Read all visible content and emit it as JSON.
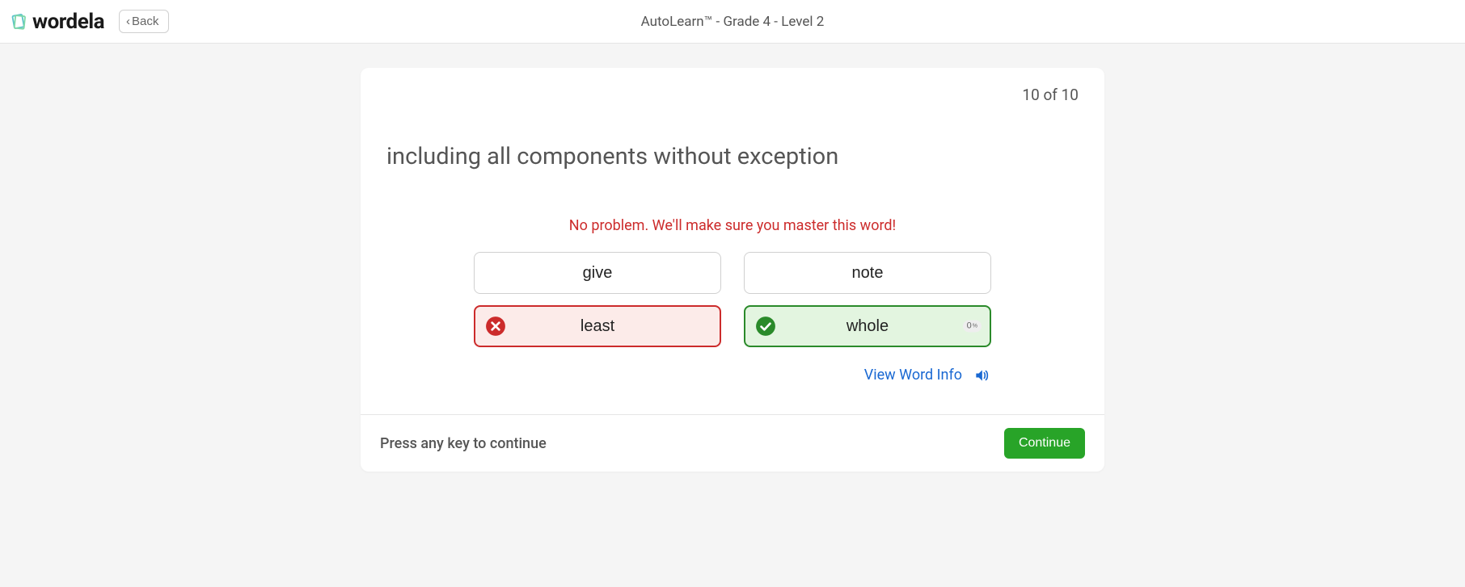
{
  "header": {
    "logo_text": "wordela",
    "back_label": "Back",
    "title": "AutoLearn™ - Grade 4 - Level 2"
  },
  "card": {
    "progress": "10 of 10",
    "prompt": "including all components without exception",
    "feedback": "No problem. We'll make sure you master this word!",
    "options": {
      "a": "give",
      "b": "note",
      "c": "least",
      "d": "whole",
      "d_badge": "0"
    },
    "view_word_info": "View Word Info"
  },
  "footer": {
    "hint": "Press any key to continue",
    "continue": "Continue"
  }
}
